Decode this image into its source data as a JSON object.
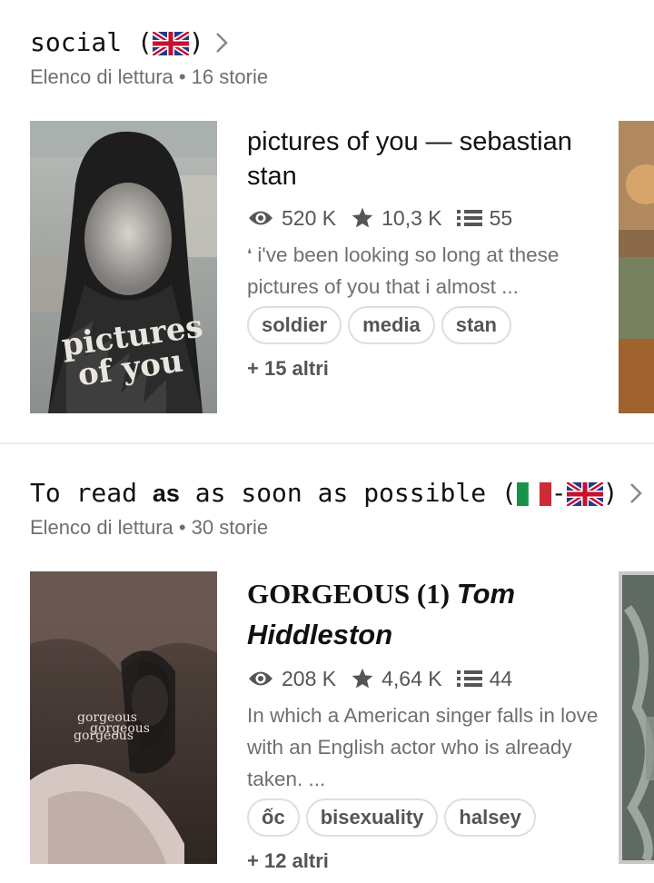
{
  "lists": [
    {
      "title_text": "social (",
      "title_end": ")",
      "subtitle": "Elenco di lettura • 16 storie",
      "story": {
        "title": "pictures of you — sebastian stan",
        "reads": "520 K",
        "votes": "10,3 K",
        "parts": "55",
        "description": "i've been looking so long at these pictures of you that i almost ...",
        "tags": [
          "soldier",
          "media",
          "stan"
        ],
        "more": "+ 15 altri",
        "cover_text_1": "pictures",
        "cover_text_2": "of you"
      }
    },
    {
      "title_a": "To read ",
      "title_b": "as",
      "title_c": " as soon as possible (",
      "title_d": "-",
      "title_end": ")",
      "subtitle": "Elenco di lettura • 30 storie",
      "story": {
        "title_plain": "GORGEOUS (1) ",
        "title_italic": "Tom Hiddleston",
        "reads": "208 K",
        "votes": "4,64 K",
        "parts": "44",
        "description": "In which a American singer falls in love with an English actor who is already taken. ...",
        "tags": [
          "ốc",
          "bisexuality",
          "halsey"
        ],
        "more": "+ 12 altri",
        "cover_text": "gorgeous gorgeous gorgeous"
      }
    }
  ],
  "icons": [
    "chevron-right-icon",
    "eye-icon",
    "star-icon",
    "list-icon",
    "uk-flag-icon",
    "italy-flag-icon"
  ],
  "colors": {
    "text": "#111111",
    "muted": "#6f6f6f",
    "tag_border": "#dedede",
    "divider": "#ebebeb"
  }
}
